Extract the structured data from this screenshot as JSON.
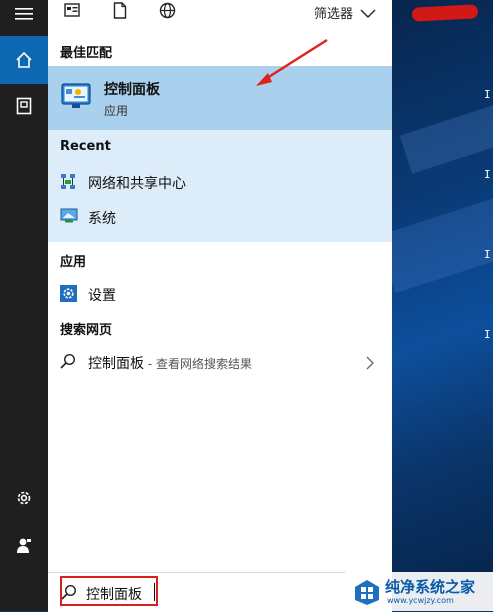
{
  "toolbar": {
    "filter_label": "筛选器",
    "icons": [
      "apps-list-icon",
      "document-icon",
      "globe-icon",
      "chevron-down-icon"
    ]
  },
  "rail": {
    "icons": [
      "hamburger-menu-icon",
      "home-icon",
      "device-icon",
      "settings-gear-icon",
      "user-feedback-icon"
    ],
    "active": "home-icon",
    "accent_color": "#0e67b1"
  },
  "best_match": {
    "header": "最佳匹配",
    "title": "控制面板",
    "subtitle": "应用",
    "highlight_color": "#a9d0ec",
    "icon": "control-panel-icon"
  },
  "recent": {
    "header": "Recent",
    "items": [
      {
        "label": "网络和共享中心",
        "icon": "network-sharing-center-icon"
      },
      {
        "label": "系统",
        "icon": "system-monitor-icon"
      }
    ],
    "background_color": "#dcecf8"
  },
  "apps": {
    "header": "应用",
    "items": [
      {
        "label": "设置",
        "icon": "settings-app-icon"
      }
    ]
  },
  "web": {
    "header": "搜索网页",
    "items": [
      {
        "label": "控制面板",
        "suffix": " - 查看网络搜索结果",
        "icon": "search-icon"
      }
    ]
  },
  "search": {
    "value": "控制面板",
    "highlight_color": "#d9221c"
  },
  "desktop": {
    "edge_chars": [
      "I",
      "I",
      "I",
      "I"
    ],
    "watermark_title": "纯净系统之家",
    "watermark_url": "www.ycwjzy.com"
  },
  "annotation": {
    "arrow_color": "#e0201a"
  }
}
